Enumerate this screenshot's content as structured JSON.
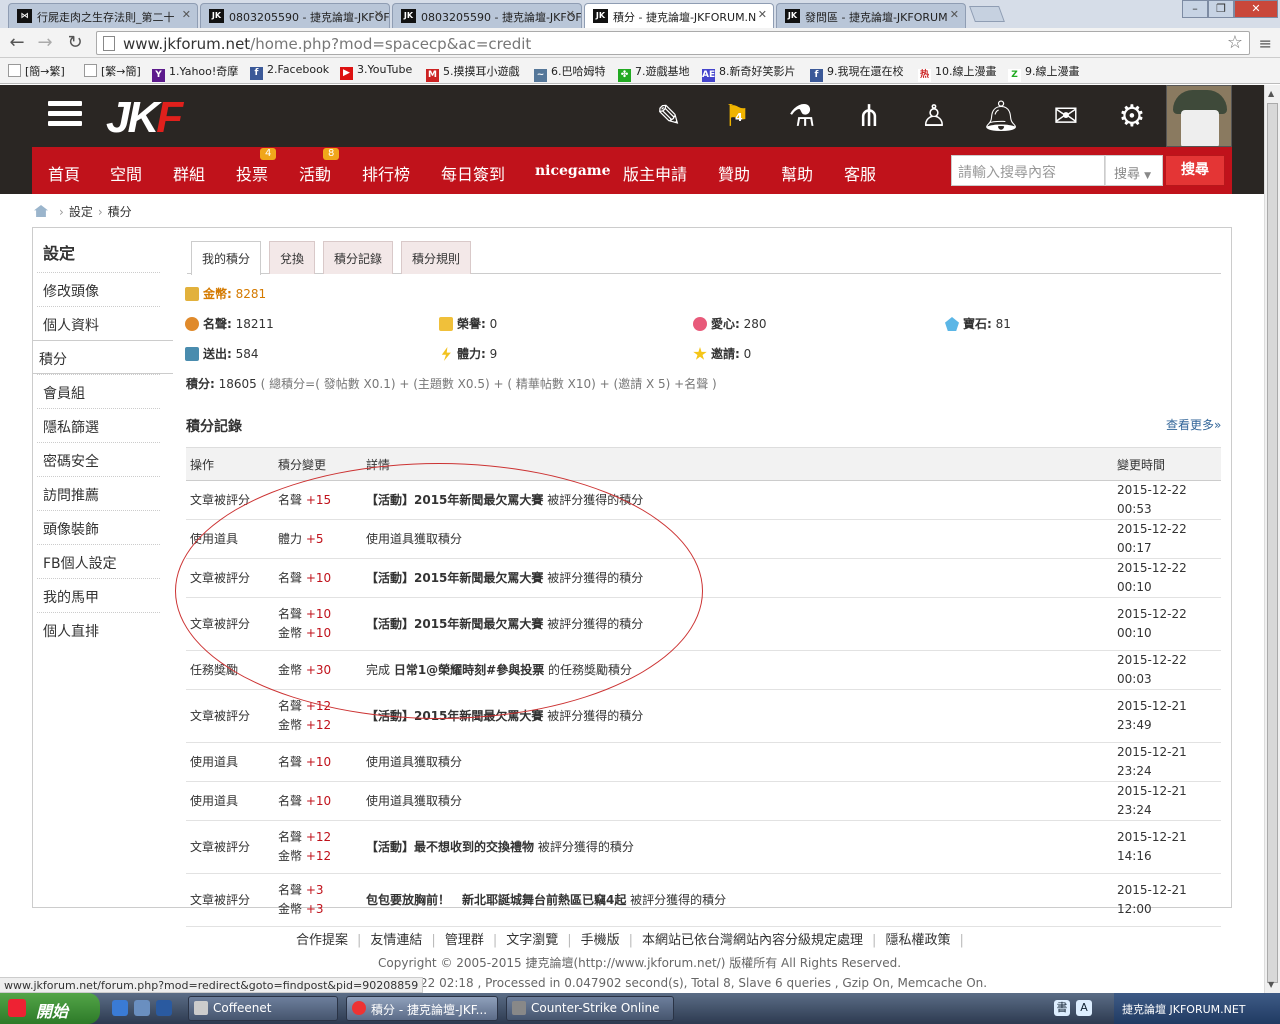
{
  "browser": {
    "tabs": [
      {
        "title": "行屍走肉之生存法則_第二十",
        "fav": "⋈"
      },
      {
        "title": "0803205590 - 捷克論壇-JKFOF",
        "fav": "JK"
      },
      {
        "title": "0803205590 - 捷克論壇-JKFOF",
        "fav": "JK"
      },
      {
        "title": "積分 - 捷克論壇-JKFORUM.N",
        "fav": "JK"
      },
      {
        "title": "發問區 - 捷克論壇-JKFORUM",
        "fav": "JK"
      }
    ],
    "url_host": "www.jkforum.net",
    "url_path": "/home.php?mod=spacecp&ac=credit",
    "bookmarks": [
      "[簡→繁]",
      "[繁→簡]",
      "1.Yahoo!奇摩",
      "2.Facebook",
      "3.YouTube",
      "5.摸摸耳小遊戲",
      "6.巴哈姆特",
      "7.遊戲基地",
      "8.新奇好笑影片",
      "9.我現在還在校",
      "10.線上漫畫",
      "9.線上漫畫"
    ],
    "status_url": "www.jkforum.net/forum.php?mod=redirect&goto=findpost&pid=90208859"
  },
  "site": {
    "logo_main": "JK",
    "logo_accent": "F",
    "flag_badge": "4",
    "nav": [
      {
        "label": "首頁",
        "badge": ""
      },
      {
        "label": "空間",
        "badge": ""
      },
      {
        "label": "群組",
        "badge": ""
      },
      {
        "label": "投票",
        "badge": "4"
      },
      {
        "label": "活動",
        "badge": "8"
      },
      {
        "label": "排行榜",
        "badge": ""
      },
      {
        "label": "每日簽到",
        "badge": ""
      },
      {
        "label": "nicegame",
        "badge": ""
      },
      {
        "label": "版主申請",
        "badge": ""
      },
      {
        "label": "贊助",
        "badge": ""
      },
      {
        "label": "幫助",
        "badge": ""
      },
      {
        "label": "客服",
        "badge": ""
      }
    ],
    "search_placeholder": "請輸入搜尋內容",
    "search_type": "搜尋",
    "search_button": "搜尋"
  },
  "breadcrumb": [
    "設定",
    "積分"
  ],
  "sidebar": {
    "title": "設定",
    "items": [
      "修改頭像",
      "個人資料",
      "積分",
      "會員組",
      "隱私篩選",
      "密碼安全",
      "訪問推薦",
      "頭像裝飾",
      "FB個人設定",
      "我的馬甲",
      "個人直排"
    ]
  },
  "tabs": [
    "我的積分",
    "兌換",
    "積分記錄",
    "積分規則"
  ],
  "credits": {
    "gold_label": "金幣:",
    "gold_value": "8281",
    "fame_label": "名聲:",
    "fame_value": "18211",
    "honor_label": "榮譽:",
    "honor_value": "0",
    "love_label": "愛心:",
    "love_value": "280",
    "gem_label": "寶石:",
    "gem_value": "81",
    "sent_label": "送出:",
    "sent_value": "584",
    "power_label": "體力:",
    "power_value": "9",
    "invite_label": "邀請:",
    "invite_value": "0",
    "total_label": "積分:",
    "total_value": "18605",
    "formula": "( 總積分=( 發帖數 X0.1) + (主題數 X0.5) + ( 精華帖數 X10) + (邀請 X 5) +名聲 )"
  },
  "log": {
    "title": "積分記錄",
    "more": "查看更多»",
    "headers": [
      "操作",
      "積分變更",
      "詳情",
      "變更時間"
    ],
    "rows": [
      {
        "op": "文章被評分",
        "changes": [
          [
            "名聲",
            "+15"
          ]
        ],
        "prefix": "",
        "bold": "【活動】2015年新聞最欠罵大賽",
        "suffix": " 被評分獲得的積分",
        "time": "2015-12-22 00:53"
      },
      {
        "op": "使用道具",
        "changes": [
          [
            "體力",
            "+5"
          ]
        ],
        "prefix": "使用道具獲取積分",
        "bold": "",
        "suffix": "",
        "time": "2015-12-22 00:17"
      },
      {
        "op": "文章被評分",
        "changes": [
          [
            "名聲",
            "+10"
          ]
        ],
        "prefix": "",
        "bold": "【活動】2015年新聞最欠罵大賽",
        "suffix": " 被評分獲得的積分",
        "time": "2015-12-22 00:10"
      },
      {
        "op": "文章被評分",
        "changes": [
          [
            "名聲",
            "+10"
          ],
          [
            "金幣",
            "+10"
          ]
        ],
        "prefix": "",
        "bold": "【活動】2015年新聞最欠罵大賽",
        "suffix": " 被評分獲得的積分",
        "time": "2015-12-22 00:10"
      },
      {
        "op": "任務獎勵",
        "changes": [
          [
            "金幣",
            "+30"
          ]
        ],
        "prefix": "完成 ",
        "bold": "日常1@榮耀時刻#參與投票",
        "suffix": " 的任務獎勵積分",
        "time": "2015-12-22 00:03"
      },
      {
        "op": "文章被評分",
        "changes": [
          [
            "名聲",
            "+12"
          ],
          [
            "金幣",
            "+12"
          ]
        ],
        "prefix": "",
        "bold": "【活動】2015年新聞最欠罵大賽",
        "suffix": " 被評分獲得的積分",
        "time": "2015-12-21 23:49"
      },
      {
        "op": "使用道具",
        "changes": [
          [
            "名聲",
            "+10"
          ]
        ],
        "prefix": "使用道具獲取積分",
        "bold": "",
        "suffix": "",
        "time": "2015-12-21 23:24"
      },
      {
        "op": "使用道具",
        "changes": [
          [
            "名聲",
            "+10"
          ]
        ],
        "prefix": "使用道具獲取積分",
        "bold": "",
        "suffix": "",
        "time": "2015-12-21 23:24"
      },
      {
        "op": "文章被評分",
        "changes": [
          [
            "名聲",
            "+12"
          ],
          [
            "金幣",
            "+12"
          ]
        ],
        "prefix": "",
        "bold": "【活動】最不想收到的交換禮物",
        "suffix": " 被評分獲得的積分",
        "time": "2015-12-21 14:16"
      },
      {
        "op": "文章被評分",
        "changes": [
          [
            "名聲",
            "+3"
          ],
          [
            "金幣",
            "+3"
          ]
        ],
        "prefix": "",
        "bold": "包包要放胸前！　新北耶誕城舞台前熱區已竊4起",
        "suffix": " 被評分獲得的積分",
        "time": "2015-12-21 12:00"
      }
    ]
  },
  "footer": {
    "links": [
      "合作提案",
      "友情連結",
      "管理群",
      "文字瀏覽",
      "手機版",
      "本網站已依台灣網站內容分級規定處理",
      "隱私權政策"
    ],
    "copyright": "Copyright © 2005-2015 捷克論壇(http://www.jkforum.net/) 版權所有 All Rights Reserved.",
    "process": "22 02:18 , Processed in 0.047902 second(s), Total 8, Slave 6 queries , Gzip On, Memcache On."
  },
  "taskbar": {
    "start": "開始",
    "tasks": [
      "Coffeenet",
      "積分 - 捷克論壇-JKF...",
      "Counter-Strike Online"
    ],
    "tray_text": "捷克論壇 JKFORUM.NET"
  }
}
